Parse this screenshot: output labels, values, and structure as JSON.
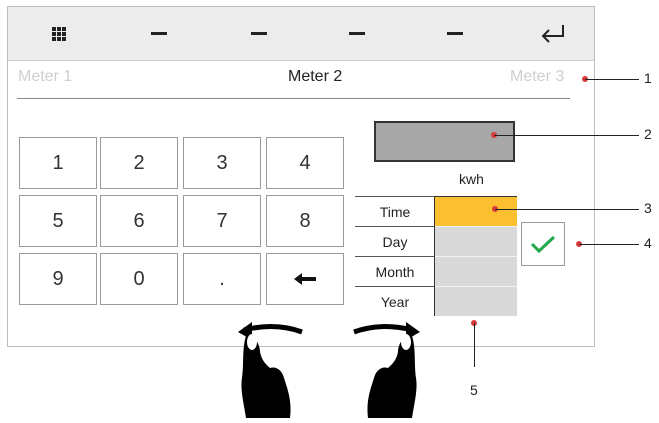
{
  "topbar": {
    "icons": [
      "keypad-grid-icon",
      "dash-icon",
      "dash-icon",
      "dash-icon",
      "dash-icon",
      "return-arrow-icon"
    ]
  },
  "tabs": [
    {
      "label": "Meter 1",
      "active": false
    },
    {
      "label": "Meter 2",
      "active": true
    },
    {
      "label": "Meter 3",
      "active": false
    }
  ],
  "keypad": {
    "keys": [
      "1",
      "2",
      "3",
      "4",
      "5",
      "6",
      "7",
      "8",
      "9",
      "0",
      ".",
      "backspace-arrow-icon"
    ]
  },
  "reading": {
    "unit": "kwh",
    "rows": [
      {
        "label": "Time",
        "selected": true
      },
      {
        "label": "Day",
        "selected": false
      },
      {
        "label": "Month",
        "selected": false
      },
      {
        "label": "Year",
        "selected": false
      }
    ]
  },
  "confirm": {
    "icon": "checkmark-icon"
  },
  "gesture": {
    "icons": [
      "swipe-left-hand-icon",
      "swipe-right-hand-icon"
    ]
  },
  "callouts": [
    "1",
    "2",
    "3",
    "4",
    "5"
  ],
  "colors": {
    "selected": "#fbbf2f",
    "accent_check": "#22a84a",
    "callout_dot": "#d93a3a"
  }
}
